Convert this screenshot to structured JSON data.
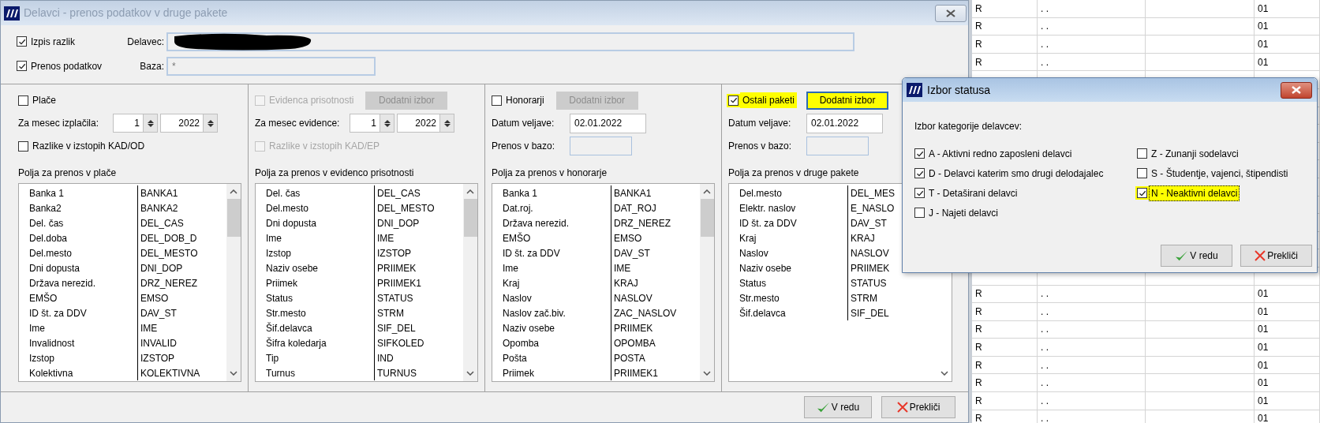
{
  "window": {
    "title": "Delavci - prenos podatkov v druge pakete"
  },
  "header": {
    "options": [
      {
        "label": "Izpis razlik",
        "checked": true
      },
      {
        "label": "Prenos podatkov",
        "checked": true
      }
    ],
    "fields": [
      {
        "label": "Delavec:",
        "redacted": true
      },
      {
        "label": "Baza:",
        "value": "*",
        "redacted": false
      }
    ]
  },
  "panels": [
    {
      "kind": "month",
      "checkbox": {
        "label": "Plače",
        "checked": false,
        "disabled": false,
        "highlighted": false
      },
      "period": {
        "label": "Za mesec izplačila:",
        "month": "1",
        "year": "2022"
      },
      "option": {
        "label": "Razlike v izstopih KAD/OD",
        "checked": false,
        "disabled": false,
        "highlighted": false
      },
      "list": {
        "heading": "Polja za prenos v plače",
        "scrollbar_enabled": true,
        "rows": [
          {
            "name": "Banka 1",
            "code": "BANKA1"
          },
          {
            "name": "Banka2",
            "code": "BANKA2"
          },
          {
            "name": "Del. čas",
            "code": "DEL_CAS"
          },
          {
            "name": "Del.doba",
            "code": "DEL_DOB_D"
          },
          {
            "name": "Del.mesto",
            "code": "DEL_MESTO"
          },
          {
            "name": "Dni dopusta",
            "code": "DNI_DOP"
          },
          {
            "name": "Država nerezid.",
            "code": "DRZ_NEREZ"
          },
          {
            "name": "EMŠO",
            "code": "EMSO"
          },
          {
            "name": "ID št. za DDV",
            "code": "DAV_ST"
          },
          {
            "name": "Ime",
            "code": "IME"
          },
          {
            "name": "Invalidnost",
            "code": "INVALID"
          },
          {
            "name": "Izstop",
            "code": "IZSTOP"
          },
          {
            "name": "Kolektivna",
            "code": "KOLEKTIVNA"
          }
        ]
      }
    },
    {
      "kind": "month",
      "checkbox": {
        "label": "Evidenca prisotnosti",
        "checked": false,
        "disabled": true,
        "highlighted": false
      },
      "button": {
        "label": "Dodatni izbor",
        "disabled": true,
        "highlighted": false
      },
      "period": {
        "label": "Za mesec evidence:",
        "month": "1",
        "year": "2022"
      },
      "option": {
        "label": "Razlike v izstopih KAD/EP",
        "checked": false,
        "disabled": true,
        "highlighted": false
      },
      "list": {
        "heading": "Polja za prenos v evidenco prisotnosti",
        "scrollbar_enabled": true,
        "rows": [
          {
            "name": "Del. čas",
            "code": "DEL_CAS"
          },
          {
            "name": "Del.mesto",
            "code": "DEL_MESTO"
          },
          {
            "name": "Dni dopusta",
            "code": "DNI_DOP"
          },
          {
            "name": "Ime",
            "code": "IME"
          },
          {
            "name": "Izstop",
            "code": "IZSTOP"
          },
          {
            "name": "Naziv osebe",
            "code": "PRIIMEK"
          },
          {
            "name": "Priimek",
            "code": "PRIIMEK1"
          },
          {
            "name": "Status",
            "code": "STATUS"
          },
          {
            "name": "Str.mesto",
            "code": "STRM"
          },
          {
            "name": "Šif.delavca",
            "code": "SIF_DEL"
          },
          {
            "name": "Šifra koledarja",
            "code": "SIFKOLED"
          },
          {
            "name": "Tip",
            "code": "IND"
          },
          {
            "name": "Turnus",
            "code": "TURNUS"
          }
        ]
      }
    },
    {
      "kind": "date",
      "checkbox": {
        "label": "Honorarji",
        "checked": false,
        "disabled": false,
        "highlighted": false
      },
      "button": {
        "label": "Dodatni izbor",
        "disabled": true,
        "highlighted": false
      },
      "date": {
        "label": "Datum veljave:",
        "value": "02.01.2022"
      },
      "target": {
        "label": "Prenos v bazo:"
      },
      "list": {
        "heading": "Polja za prenos v honorarje",
        "scrollbar_enabled": true,
        "rows": [
          {
            "name": "Banka 1",
            "code": "BANKA1"
          },
          {
            "name": "Dat.roj.",
            "code": "DAT_ROJ"
          },
          {
            "name": "Država nerezid.",
            "code": "DRZ_NEREZ"
          },
          {
            "name": "EMŠO",
            "code": "EMSO"
          },
          {
            "name": "ID št. za DDV",
            "code": "DAV_ST"
          },
          {
            "name": "Ime",
            "code": "IME"
          },
          {
            "name": "Kraj",
            "code": "KRAJ"
          },
          {
            "name": "Naslov",
            "code": "NASLOV"
          },
          {
            "name": "Naslov zač.biv.",
            "code": "ZAC_NASLOV"
          },
          {
            "name": "Naziv osebe",
            "code": "PRIIMEK"
          },
          {
            "name": "Opomba",
            "code": "OPOMBA"
          },
          {
            "name": "Pošta",
            "code": "POSTA"
          },
          {
            "name": "Priimek",
            "code": "PRIIMEK1"
          }
        ]
      }
    },
    {
      "kind": "date",
      "checkbox": {
        "label": "Ostali paketi",
        "checked": true,
        "disabled": false,
        "highlighted": true
      },
      "button": {
        "label": "Dodatni izbor",
        "disabled": false,
        "highlighted": true
      },
      "date": {
        "label": "Datum veljave:",
        "value": "02.01.2022"
      },
      "target": {
        "label": "Prenos v bazo:"
      },
      "list": {
        "heading": "Polja za prenos v druge pakete",
        "scrollbar_enabled": false,
        "rows": [
          {
            "name": "Del.mesto",
            "code": "DEL_MES"
          },
          {
            "name": "Elektr. naslov",
            "code": "E_NASLO"
          },
          {
            "name": "ID št. za DDV",
            "code": "DAV_ST"
          },
          {
            "name": "Kraj",
            "code": "KRAJ"
          },
          {
            "name": "Naslov",
            "code": "NASLOV"
          },
          {
            "name": "Naziv osebe",
            "code": "PRIIMEK"
          },
          {
            "name": "Status",
            "code": "STATUS"
          },
          {
            "name": "Str.mesto",
            "code": "STRM"
          },
          {
            "name": "Šif.delavca",
            "code": "SIF_DEL"
          }
        ]
      }
    }
  ],
  "footer_buttons": [
    {
      "kind": "ok",
      "label": "V redu"
    },
    {
      "kind": "cancel",
      "label": "Prekliči"
    }
  ],
  "dialog": {
    "title": "Izbor statusa",
    "prompt": "Izbor kategorije delavcev:",
    "columns": [
      [
        {
          "label": "A - Aktivni redno zaposleni delavci",
          "checked": true,
          "highlighted": false,
          "focused": false
        },
        {
          "label": "D - Delavci katerim smo drugi delodajalec",
          "checked": true,
          "highlighted": false,
          "focused": false
        },
        {
          "label": "T - Detaširani delavci",
          "checked": true,
          "highlighted": false,
          "focused": false
        },
        {
          "label": "J - Najeti delavci",
          "checked": false,
          "highlighted": false,
          "focused": false
        }
      ],
      [
        {
          "label": "Z - Zunanji sodelavci",
          "checked": false,
          "highlighted": false,
          "focused": false
        },
        {
          "label": "S - Študentje, vajenci, štipendisti",
          "checked": false,
          "highlighted": false,
          "focused": false
        },
        {
          "label": "N - Neaktivni delavci",
          "checked": true,
          "highlighted": true,
          "focused": true
        }
      ]
    ],
    "buttons": [
      {
        "kind": "ok",
        "label": "V redu"
      },
      {
        "kind": "cancel",
        "label": "Prekliči"
      }
    ]
  },
  "table": {
    "rows_above_dialog": [
      {
        "column_1": "R",
        "column_2": ". .",
        "column_4": "01"
      },
      {
        "column_1": "R",
        "column_2": ". .",
        "column_4": "01"
      },
      {
        "column_1": "R",
        "column_2": ". .",
        "column_4": "01"
      },
      {
        "column_1": "R",
        "column_2": ". .",
        "column_4": "01"
      }
    ],
    "rows_below_dialog": [
      {
        "column_1": "R",
        "column_2": ". .",
        "column_4": "01"
      },
      {
        "column_1": "R",
        "column_2": ". .",
        "column_4": "01"
      },
      {
        "column_1": "R",
        "column_2": ". .",
        "column_4": "01"
      },
      {
        "column_1": "R",
        "column_2": ". .",
        "column_4": "01"
      },
      {
        "column_1": "R",
        "column_2": ". .",
        "column_4": "01"
      },
      {
        "column_1": "R",
        "column_2": ". .",
        "column_4": "01"
      },
      {
        "column_1": "R",
        "column_2": ". .",
        "column_4": "01"
      },
      {
        "column_1": "R",
        "column_2": ". .",
        "column_4": "01"
      }
    ]
  }
}
